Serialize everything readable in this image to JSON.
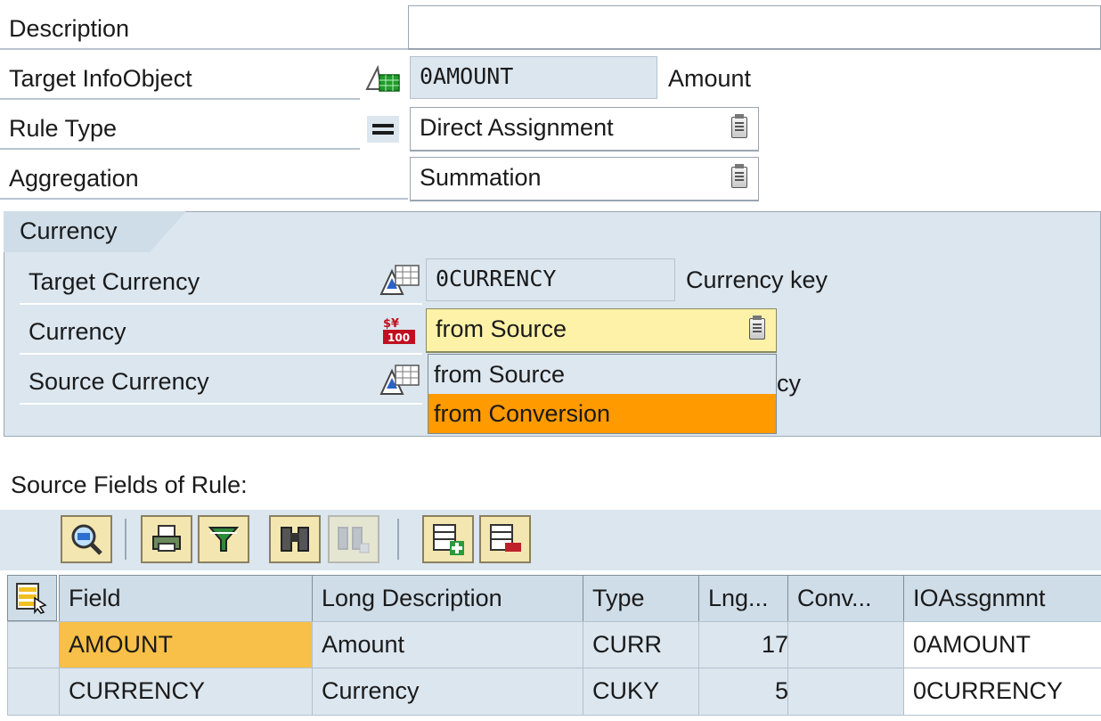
{
  "form": {
    "description": {
      "label": "Description",
      "value": ""
    },
    "target_infoobject": {
      "label": "Target InfoObject",
      "value": "0AMOUNT",
      "text": "Amount"
    },
    "rule_type": {
      "label": "Rule Type",
      "value": "Direct Assignment"
    },
    "aggregation": {
      "label": "Aggregation",
      "value": "Summation"
    }
  },
  "currency_group": {
    "title": "Currency",
    "target_currency": {
      "label": "Target Currency",
      "value": "0CURRENCY",
      "text": "Currency key"
    },
    "currency": {
      "label": "Currency",
      "value": "from Source"
    },
    "source_currency": {
      "label": "Source Currency",
      "text_partial": "cy"
    },
    "dropdown_options": [
      "from Source",
      "from Conversion"
    ],
    "highlighted_option": "from Conversion"
  },
  "source_fields": {
    "title": "Source Fields of Rule:",
    "toolbar_icons": [
      "details-icon",
      "print-icon",
      "filter-icon",
      "find-icon",
      "find-next-icon",
      "insert-row-icon",
      "delete-row-icon"
    ],
    "columns": [
      "Field",
      "Long Description",
      "Type",
      "Lng...",
      "Conv...",
      "IOAssgnmnt"
    ],
    "rows": [
      {
        "field": "AMOUNT",
        "long_description": "Amount",
        "type": "CURR",
        "length": "17",
        "conv": "",
        "io_assignment": "0AMOUNT"
      },
      {
        "field": "CURRENCY",
        "long_description": "Currency",
        "type": "CUKY",
        "length": "5",
        "conv": "",
        "io_assignment": "0CURRENCY"
      }
    ]
  },
  "colors": {
    "panel_blue": "#dbe6ef",
    "highlight_orange": "#ff9a00",
    "selected_cell": "#f8c048",
    "dropdown_field_yellow": "#fdf2a8"
  }
}
